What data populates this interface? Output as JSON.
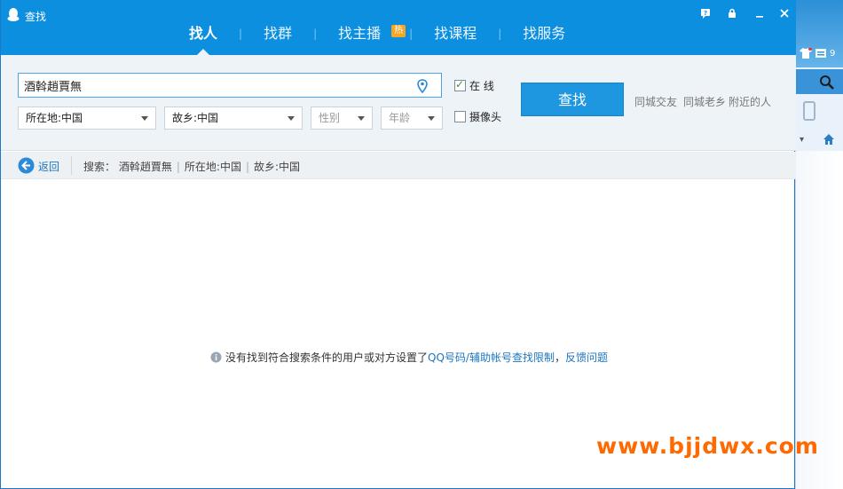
{
  "window": {
    "title": "查找"
  },
  "controls": {
    "help": "?",
    "lock": "⊕",
    "minimize": "—",
    "close": "✕"
  },
  "tabs": [
    {
      "label": "找人",
      "active": true
    },
    {
      "label": "找群"
    },
    {
      "label": "找主播",
      "badge": "热"
    },
    {
      "label": "找课程"
    },
    {
      "label": "找服务"
    }
  ],
  "search": {
    "keyword": "酒斡趙賈無",
    "location_select": "所在地:中国",
    "hometown_select": "故乡:中国",
    "gender_select": "性别",
    "age_select": "年龄",
    "online_label": "在  线",
    "online_checked": true,
    "camera_label": "摄像头",
    "camera_checked": false,
    "find_button": "查找",
    "quick_links": [
      "同城交友",
      "同城老乡",
      "附近的人"
    ]
  },
  "breadcrumb": {
    "back_label": "返回",
    "prefix": "搜索：",
    "items": [
      "酒斡趙賈無",
      "所在地:中国",
      "故乡:中国"
    ]
  },
  "result": {
    "message": "没有找到符合搜索条件的用户或对方设置了",
    "link1": "QQ号码/辅助帐号查找限制",
    "comma": "，",
    "link2": "反馈问题"
  },
  "background_panel": {
    "badge_count": "9"
  },
  "watermark": "www.bjjdwx.com",
  "colors": {
    "title_blue": "#0d8fe0",
    "button_blue": "#1e96e0",
    "link_blue": "#1e76c0",
    "watermark": "#ff6a00"
  }
}
